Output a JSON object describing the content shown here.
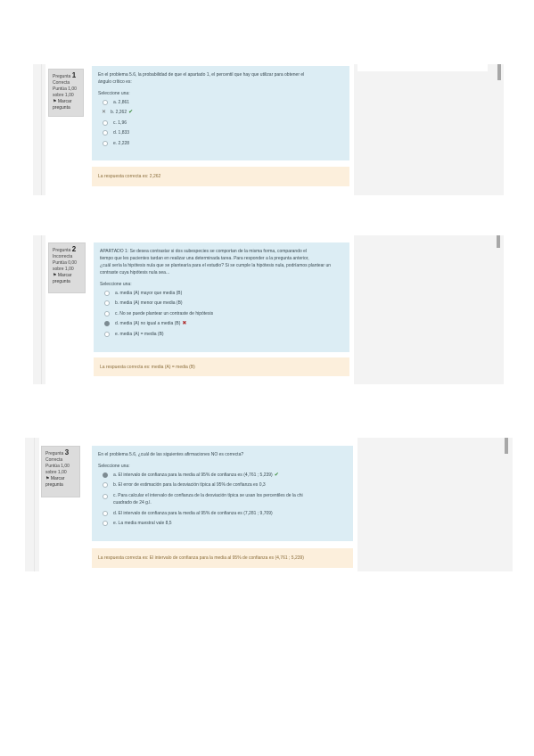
{
  "questions": [
    {
      "info": {
        "label": "Pregunta",
        "number": "1",
        "status": "Correcta",
        "score": "Puntúa 1,00 sobre 1,00",
        "flag": "Marcar pregunta"
      },
      "text": "En el problema 5.6, la probabilidad de que el apartado 1, el percentil que hay que utilizar para obtener el",
      "text2": "ángulo crítico es:",
      "select_label": "Seleccione una:",
      "options": [
        {
          "label": "a. 2,861",
          "state": "none"
        },
        {
          "label": "b. 2,262",
          "state": "selected-correct"
        },
        {
          "label": "c. 1,96",
          "state": "none"
        },
        {
          "label": "d. 1,833",
          "state": "none"
        },
        {
          "label": "e. 2,228",
          "state": "none"
        }
      ],
      "feedback": "La respuesta correcta es: 2,262"
    },
    {
      "info": {
        "label": "Pregunta",
        "number": "2",
        "status": "Incorrecta",
        "score": "Puntúa 0,00 sobre 1,00",
        "flag": "Marcar pregunta"
      },
      "text": "APARTADO 1: Se desea contrastar si dos subespecies se comportan de la misma forma, comparando el",
      "text2": "tiempo que les pacientes tardan en realizar una determinada tarea. Para responder a la pregunta anterior,",
      "text3": "¿cuál sería la hipótesis nula que se plantearía para el estudio? Si se cumple la hipótesis nula, podríamos plantear un",
      "text4": "contraste cuya hipótesis nula sea...",
      "select_label": "Seleccione una:",
      "options": [
        {
          "label": "a. media (A) mayor que media (B)",
          "state": "none"
        },
        {
          "label": "b. media (A) menor que media (B)",
          "state": "none"
        },
        {
          "label": "c. No se puede plantear un contraste de hipótesis",
          "state": "none"
        },
        {
          "label": "d. media (A) no igual a media (B)",
          "state": "selected-wrong"
        },
        {
          "label": "e. media (A) = media (B)",
          "state": "none"
        }
      ],
      "feedback": "La respuesta correcta es: media (A) = media (B)"
    },
    {
      "info": {
        "label": "Pregunta",
        "number": "3",
        "status": "Correcta",
        "score": "Puntúa 1,00 sobre 1,00",
        "flag": "Marcar pregunta"
      },
      "text": "En el problema 5.6, ¿cuál de las siguientes afirmaciones NO es correcta?",
      "select_label": "Seleccione una:",
      "options": [
        {
          "label": "a. El intervalo de confianza para la media al 95% de confianza es (4,761 ; 5,239)",
          "state": "selected-correct"
        },
        {
          "label": "b. El error de estimación para la desviación típica al 95% de confianza es 0,3",
          "state": "none"
        },
        {
          "label": "c. Para calcular el intervalo de confianza de la desviación típica se usan los percentiles de la chi",
          "label2": "cuadrado de 24 g.l.",
          "state": "none"
        },
        {
          "label": "d. El intervalo de confianza para la media al 95% de confianza es (7,281 ; 9,709)",
          "state": "none"
        },
        {
          "label": "e. La media muestral vale 8,5",
          "state": "none"
        }
      ],
      "feedback": "La respuesta correcta es: El intervalo de confianza para la media al 95% de confianza es (4,761 ; 5,239)"
    }
  ],
  "icons": {
    "correct": "✔",
    "incorrect": "✖",
    "crossed": "✕"
  }
}
